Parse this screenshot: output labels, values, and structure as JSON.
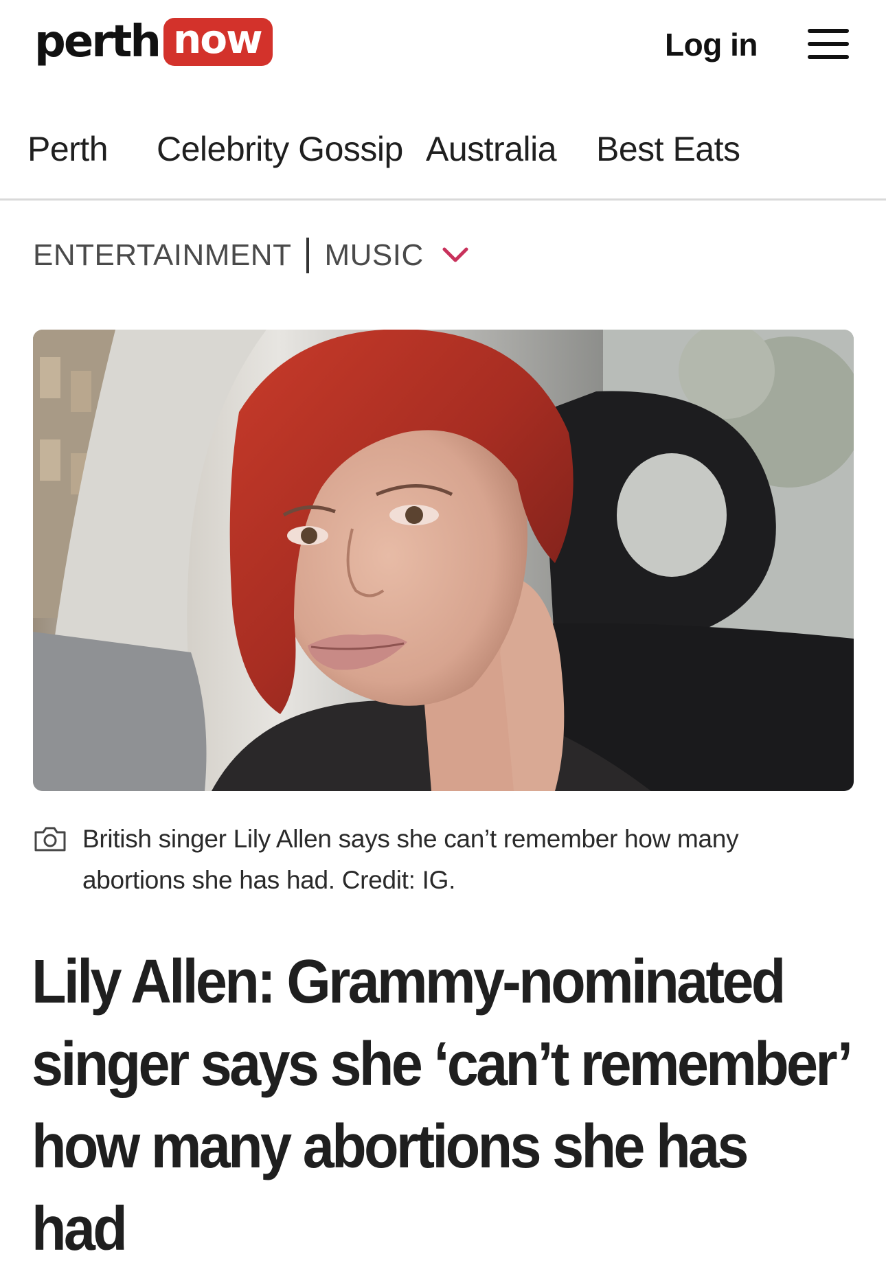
{
  "header": {
    "logo_part1": "perth",
    "logo_part2": "now",
    "login_label": "Log in",
    "menu_icon": "hamburger-menu-icon",
    "brand_color": "#d3322b"
  },
  "nav": {
    "items": [
      "Perth",
      "Celebrity Gossip",
      "Australia",
      "Best Eats"
    ]
  },
  "breadcrumb": {
    "section": "ENTERTAINMENT",
    "subsection": "MUSIC",
    "dropdown_icon": "chevron-down-icon",
    "accent_color": "#c8315b"
  },
  "article": {
    "image_icon": "camera-icon",
    "caption": "British singer Lily Allen says she can’t remember how many abortions she has had. Credit: IG.",
    "headline": "Lily Allen: Grammy-nominated singer says she ‘can’t remember’ how many abortions she has had"
  }
}
